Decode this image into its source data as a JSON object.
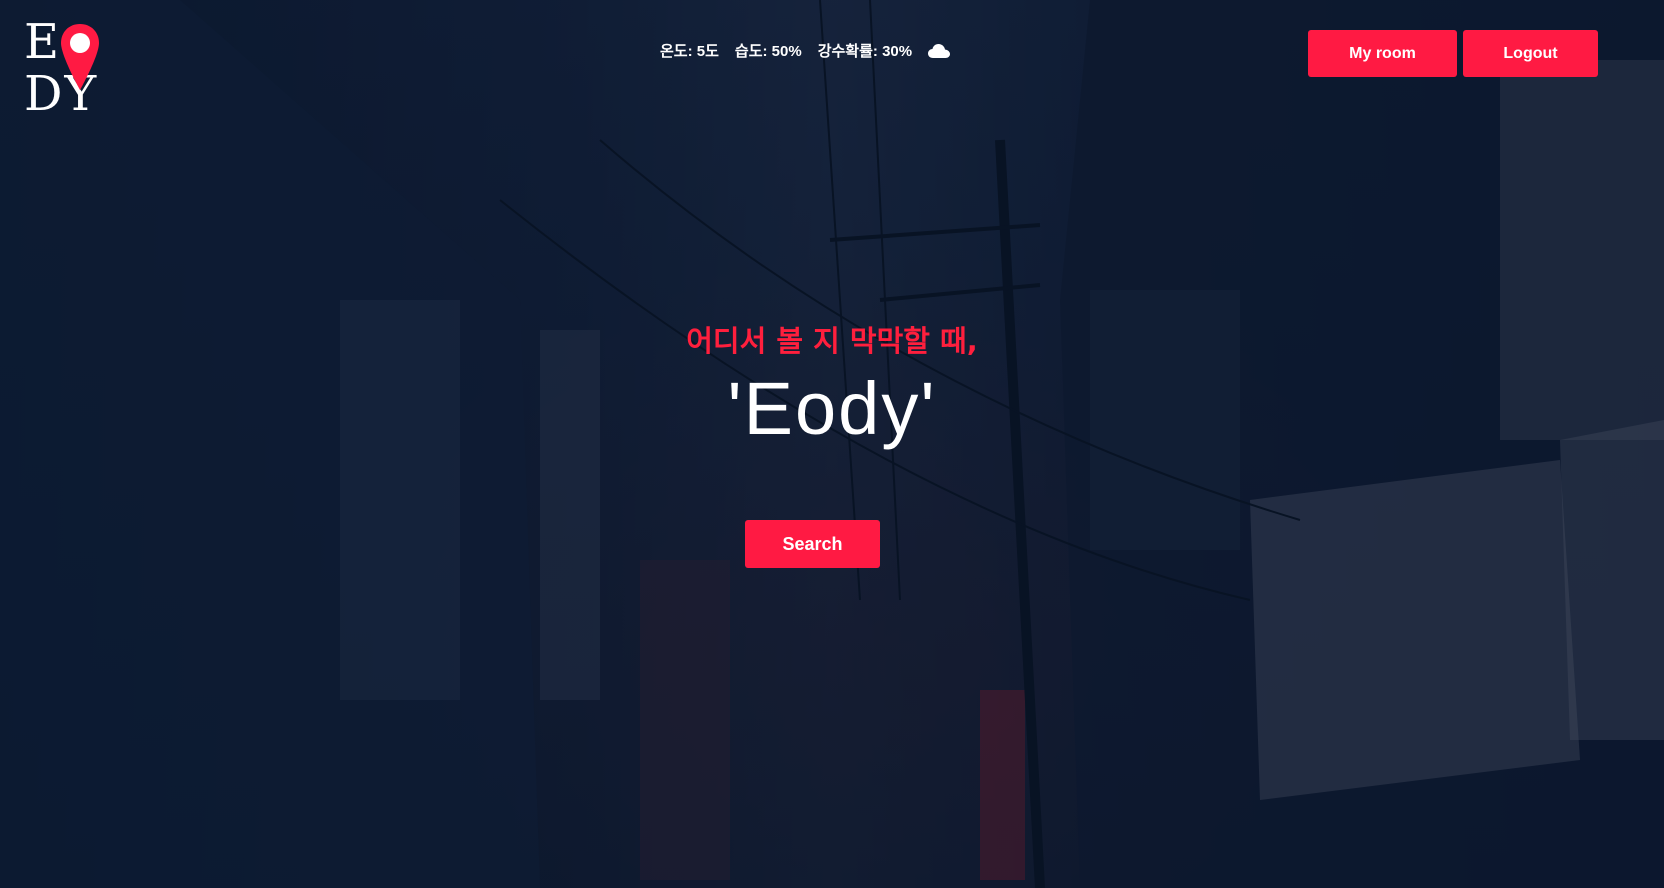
{
  "brand": {
    "logo_text": "EODY",
    "accent": "#ff1a43"
  },
  "weather": {
    "temperature": "온도: 5도",
    "humidity": "습도: 50%",
    "precipitation": "강수확률: 30%",
    "icon": "cloud-icon"
  },
  "header": {
    "myroom_label": "My room",
    "logout_label": "Logout"
  },
  "hero": {
    "subtitle": "어디서 볼 지 막막할 때,",
    "title": "'Eody'",
    "search_label": "Search"
  }
}
